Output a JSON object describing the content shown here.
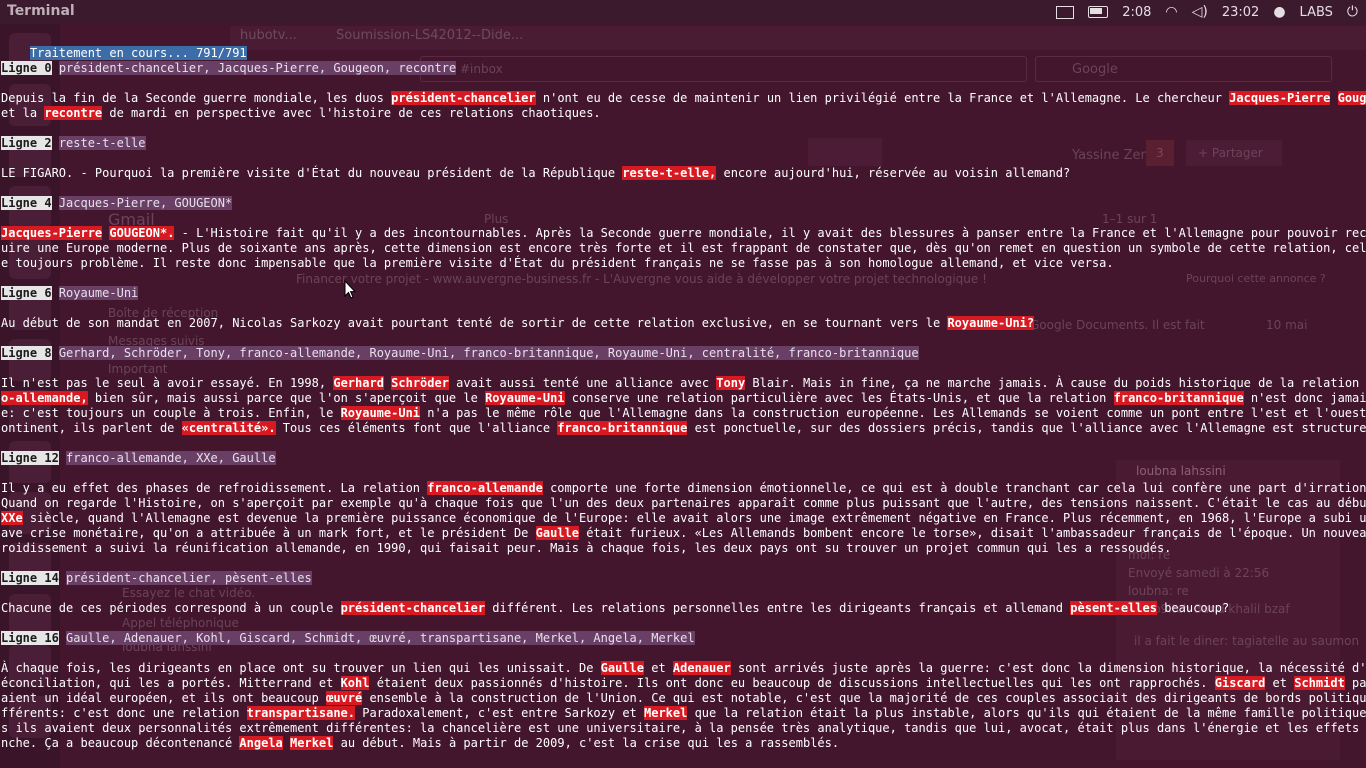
{
  "window": {
    "title": "Terminal"
  },
  "top_panel": {
    "battery_time": "2:08",
    "clock": "23:02",
    "user": "LABS"
  },
  "status_line": "Traitement en cours... 791/791",
  "lines": [
    {
      "label": "Ligne 0",
      "words": "président-chancelier, Jacques-Pierre, Gougeon, recontre",
      "paragraph": [
        [
          {
            "t": "Depuis la fin de la Seconde guerre mondiale, les duos "
          },
          {
            "t": "président-chancelier",
            "h": true
          },
          {
            "t": " n'ont eu de cesse de maintenir un lien privilégié entre la France et l'Allemagne. Le chercheur "
          },
          {
            "t": "Jacques-Pierre",
            "h": true
          },
          {
            "t": " "
          },
          {
            "t": "Gougeon",
            "h": true
          },
          {
            "t": " m"
          }
        ],
        [
          {
            "t": "et la "
          },
          {
            "t": "recontre",
            "h": true
          },
          {
            "t": " de mardi en perspective avec l'histoire de ces relations chaotiques."
          }
        ]
      ]
    },
    {
      "label": "Ligne 2",
      "words": "reste-t-elle",
      "paragraph": [
        [
          {
            "t": "LE FIGARO. - Pourquoi la première visite d'État du nouveau président de la République "
          },
          {
            "t": "reste-t-elle,",
            "h": true
          },
          {
            "t": " encore aujourd'hui, réservée au voisin allemand?"
          }
        ]
      ]
    },
    {
      "label": "Ligne 4",
      "words": "Jacques-Pierre, GOUGEON*",
      "paragraph": [
        [
          {
            "t": "Jacques-Pierre",
            "h": true
          },
          {
            "t": " "
          },
          {
            "t": "GOUGEON*.",
            "h": true
          },
          {
            "t": " - L'Histoire fait qu'il y a des incontournables. Après la Seconde guerre mondiale, il y avait des blessures à panser entre la France et l'Allemagne pour pouvoir reconstr"
          }
        ],
        [
          {
            "t": "uire une Europe moderne. Plus de soixante ans après, cette dimension est encore très forte et il est frappant de constater que, dès qu'on remet en question un symbole de cette relation, cela pos"
          }
        ],
        [
          {
            "t": "e toujours problème. Il reste donc impensable que la première visite d'État du président français ne se fasse pas à son homologue allemand, et vice versa."
          }
        ]
      ]
    },
    {
      "label": "Ligne 6",
      "words": "Royaume-Uni",
      "paragraph": [
        [
          {
            "t": "Au début de son mandat en 2007, Nicolas Sarkozy avait pourtant tenté de sortir de cette relation exclusive, en se tournant vers le "
          },
          {
            "t": "Royaume-Uni?",
            "h": true
          }
        ]
      ]
    },
    {
      "label": "Ligne 8",
      "words": "Gerhard, Schröder, Tony, franco-allemande, Royaume-Uni, franco-britannique, Royaume-Uni, centralité, franco-britannique",
      "paragraph": [
        [
          {
            "t": "Il n'est pas le seul à avoir essayé. En 1998, "
          },
          {
            "t": "Gerhard",
            "h": true
          },
          {
            "t": " "
          },
          {
            "t": "Schröder",
            "h": true
          },
          {
            "t": " avait aussi tenté une alliance avec "
          },
          {
            "t": "Tony",
            "h": true
          },
          {
            "t": " Blair. Mais in fine, ça ne marche jamais. À cause du poids historique de la relation "
          },
          {
            "t": "franc",
            "h": true
          }
        ],
        [
          {
            "t": "o-allemande,",
            "h": true
          },
          {
            "t": " bien sûr, mais aussi parce que l'on s'aperçoit que le "
          },
          {
            "t": "Royaume-Uni",
            "h": true
          },
          {
            "t": " conserve une relation particulière avec les États-Unis, et que la relation "
          },
          {
            "t": "franco-britannique",
            "h": true
          },
          {
            "t": " n'est donc jamais pur"
          }
        ],
        [
          {
            "t": "e: c'est toujours un couple à trois. Enfin, le "
          },
          {
            "t": "Royaume-Uni",
            "h": true
          },
          {
            "t": " n'a pas le même rôle que l'Allemagne dans la construction européenne. Les Allemands se voient comme un pont entre l'est et l'ouest du c"
          }
        ],
        [
          {
            "t": "ontinent, ils parlent de "
          },
          {
            "t": "«centralité».",
            "h": true
          },
          {
            "t": " Tous ces éléments font que l'alliance "
          },
          {
            "t": "franco-britannique",
            "h": true
          },
          {
            "t": " est ponctuelle, sur des dossiers précis, tandis que l'alliance avec l'Allemagne est structurelle."
          }
        ]
      ]
    },
    {
      "label": "Ligne 12",
      "words": "franco-allemande, XXe, Gaulle",
      "paragraph": [
        [
          {
            "t": "Il y a eu effet des phases de refroidissement. La relation "
          },
          {
            "t": "franco-allemande",
            "h": true
          },
          {
            "t": " comporte une forte dimension émotionnelle, ce qui est à double tranchant car cela lui confère une part d'irrationnel."
          }
        ],
        [
          {
            "t": "Quand on regarde l'Histoire, on s'aperçoit par exemple qu'à chaque fois que l'un des deux partenaires apparaît comme plus puissant que l'autre, des tensions naissent. C'était le cas au début du"
          }
        ],
        [
          {
            "t": "XXe",
            "h": true
          },
          {
            "t": " siècle, quand l'Allemagne est devenue la première puissance économique de l'Europe: elle avait alors une image extrêmement négative en France. Plus récemment, en 1968, l'Europe a subi une gr"
          }
        ],
        [
          {
            "t": "ave crise monétaire, qu'on a attribuée à un mark fort, et le président De "
          },
          {
            "t": "Gaulle",
            "h": true
          },
          {
            "t": " était furieux. «Les Allemands bombent encore le torse», disait l'ambassadeur français de l'époque. Un nouveau ref"
          }
        ],
        [
          {
            "t": "roidissement a suivi la réunification allemande, en 1990, qui faisait peur. Mais à chaque fois, les deux pays ont su trouver un projet commun qui les a ressoudés."
          }
        ]
      ]
    },
    {
      "label": "Ligne 14",
      "words": "président-chancelier, pèsent-elles",
      "paragraph": [
        [
          {
            "t": "Chacune de ces périodes correspond à un couple "
          },
          {
            "t": "président-chancelier",
            "h": true
          },
          {
            "t": " différent. Les relations personnelles entre les dirigeants français et allemand "
          },
          {
            "t": "pèsent-elles",
            "h": true
          },
          {
            "t": " beaucoup?"
          }
        ]
      ]
    },
    {
      "label": "Ligne 16",
      "words": "Gaulle, Adenauer, Kohl, Giscard, Schmidt, œuvré, transpartisane, Merkel, Angela, Merkel",
      "paragraph": [
        [
          {
            "t": "À chaque fois, les dirigeants en place ont su trouver un lien qui les unissait. De "
          },
          {
            "t": "Gaulle",
            "h": true
          },
          {
            "t": " et "
          },
          {
            "t": "Adenauer",
            "h": true
          },
          {
            "t": " sont arrivés juste après la guerre: c'est donc la dimension historique, la nécessité d'une r"
          }
        ],
        [
          {
            "t": "éconciliation, qui les a portés. Mitterrand et "
          },
          {
            "t": "Kohl",
            "h": true
          },
          {
            "t": " étaient deux passionnés d'histoire. Ils ont donc eu beaucoup de discussions intellectuelles qui les ont rapprochés. "
          },
          {
            "t": "Giscard",
            "h": true
          },
          {
            "t": " et "
          },
          {
            "t": "Schmidt",
            "h": true
          },
          {
            "t": " partage"
          }
        ],
        [
          {
            "t": "aient un idéal européen, et ils ont beaucoup "
          },
          {
            "t": "œuvré",
            "h": true
          },
          {
            "t": " ensemble à la construction de l'Union. Ce qui est notable, c'est que la majorité de ces couples associait des dirigeants de bords politiques di"
          }
        ],
        [
          {
            "t": "fférents: c'est donc une relation "
          },
          {
            "t": "transpartisane.",
            "h": true
          },
          {
            "t": " Paradoxalement, c'est entre Sarkozy et "
          },
          {
            "t": "Merkel",
            "h": true
          },
          {
            "t": " que la relation était la plus instable, alors qu'ils qui étaient de la même famille politique. Mai"
          }
        ],
        [
          {
            "t": "s ils avaient deux personnalités extrêmement différentes: la chancelière est une universitaire, à la pensée très analytique, tandis que lui, avocat, était plus dans l'énergie et les effets de ma"
          }
        ],
        [
          {
            "t": "nche. Ça a beaucoup décontenancé "
          },
          {
            "t": "Angela",
            "h": true
          },
          {
            "t": " "
          },
          {
            "t": "Merkel",
            "h": true
          },
          {
            "t": " au début. Mais à partir de 2009, c'est la crise qui les a rassemblés."
          }
        ]
      ]
    }
  ],
  "background_browser": {
    "tabs": [
      "hubotv...",
      "Soumission-LS42012--Dide..."
    ],
    "address": "#inbox",
    "search_placeholder": "Google",
    "gmail_label": "Gmail",
    "user_name": "Yassine Zenati",
    "notif_count": "3",
    "share_label": "+ Partager",
    "pagination": "1–1 sur 1",
    "more_label": "Plus",
    "ad_text": "Financer votre projet - www.auvergne-business.fr - L'Auvergne vous aide à développer votre projet technologique !",
    "ad_why": "Pourquoi cette annonce ?",
    "email_date": "10 mai",
    "email_snippet": "Google Documents. Il est fait",
    "sidebar": [
      "Boîte de réception",
      "Messages suivis",
      "Important"
    ],
    "chat_name": "loubna lahssini",
    "chat_lines": [
      "moi: re",
      "Envoyé samedi à 22:56",
      "loubna: re",
      "mab9itch 3and khalil bzaf",
      "il a fait le diner: tagiatelle au saumon"
    ],
    "chat_search": "Essayez le chat vidéo.",
    "phone_call": "Appel téléphonique"
  },
  "colors": {
    "terminal_bg": "#43162e",
    "status_bg": "#3d6da9",
    "label_bg": "#e6e6e6",
    "words_bg": "#6a3f66",
    "highlight_bg": "#d71921"
  }
}
